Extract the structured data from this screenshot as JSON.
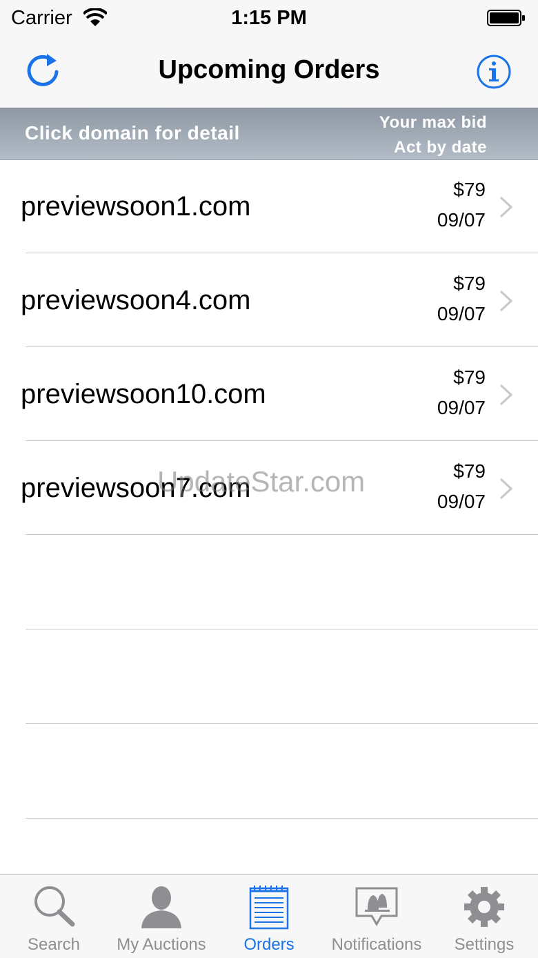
{
  "status_bar": {
    "carrier": "Carrier",
    "time": "1:15 PM"
  },
  "nav": {
    "title": "Upcoming Orders",
    "refresh_icon": "refresh-icon",
    "info_icon": "info-icon"
  },
  "header": {
    "hint": "Click domain for detail",
    "col_bid": "Your max bid",
    "col_date": "Act by date"
  },
  "orders": [
    {
      "domain": "previewsoon1.com",
      "bid": "$79",
      "date": "09/07"
    },
    {
      "domain": "previewsoon4.com",
      "bid": "$79",
      "date": "09/07"
    },
    {
      "domain": "previewsoon10.com",
      "bid": "$79",
      "date": "09/07"
    },
    {
      "domain": "previewsoon7.com",
      "bid": "$79",
      "date": "09/07"
    }
  ],
  "watermark": "UpdateStar.com",
  "tabs": [
    {
      "label": "Search",
      "icon": "search-icon"
    },
    {
      "label": "My Auctions",
      "icon": "user-icon"
    },
    {
      "label": "Orders",
      "icon": "notepad-icon",
      "active": true
    },
    {
      "label": "Notifications",
      "icon": "bell-icon"
    },
    {
      "label": "Settings",
      "icon": "gear-icon"
    }
  ],
  "colors": {
    "accent": "#1a73e8",
    "header_band": "#a3adb8",
    "tab_inactive": "#8e8e93"
  }
}
